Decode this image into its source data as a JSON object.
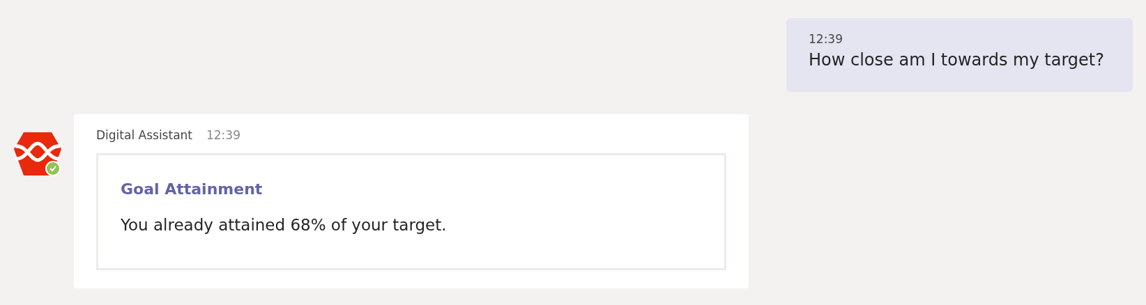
{
  "messages": [
    {
      "kind": "sent",
      "time": "12:39",
      "text": "How close am I towards my target?"
    },
    {
      "kind": "received",
      "sender": "Digital Assistant",
      "online": true,
      "time": "12:39",
      "card": {
        "title": "Goal Attainment",
        "text": "You already attained 68% of your target."
      }
    }
  ]
}
